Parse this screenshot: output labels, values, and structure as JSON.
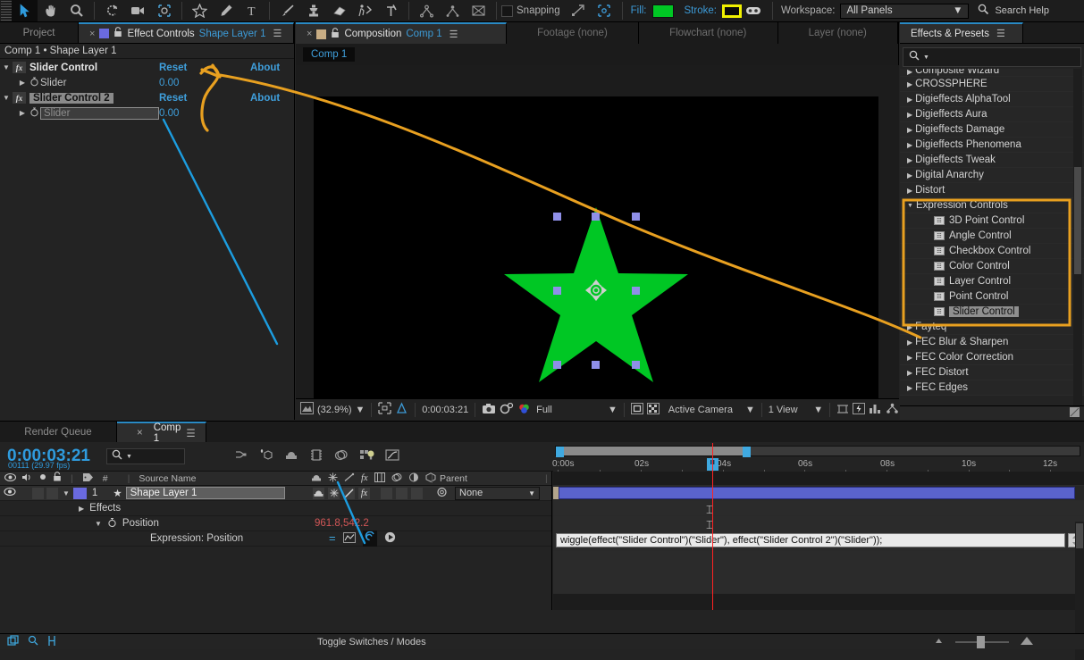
{
  "toolbar": {
    "tools": [
      {
        "name": "selection-tool",
        "glyph": "arrow",
        "selected": true
      },
      {
        "name": "hand-tool",
        "glyph": "hand",
        "selected": false
      },
      {
        "name": "zoom-tool",
        "glyph": "magnifier",
        "selected": false
      },
      {
        "name": "rotation-tool",
        "glyph": "rotate",
        "selected": false
      },
      {
        "name": "camera-tool",
        "glyph": "camera",
        "selected": false
      },
      {
        "name": "pan-behind-tool",
        "glyph": "anchor",
        "selected": false
      },
      {
        "name": "shape-tool",
        "glyph": "star",
        "selected": false
      },
      {
        "name": "pen-tool",
        "glyph": "pen",
        "selected": false
      },
      {
        "name": "type-tool",
        "glyph": "type",
        "selected": false
      },
      {
        "name": "brush-tool",
        "glyph": "brush",
        "selected": false
      },
      {
        "name": "clone-stamp-tool",
        "glyph": "stamp",
        "selected": false
      },
      {
        "name": "eraser-tool",
        "glyph": "eraser",
        "selected": false
      },
      {
        "name": "roto-brush-tool",
        "glyph": "roto",
        "selected": false
      },
      {
        "name": "puppet-pin-tool",
        "glyph": "pin",
        "selected": false
      }
    ],
    "axis_tools": [
      "local-axis",
      "world-axis",
      "view-axis"
    ],
    "snapping_label": "Snapping",
    "fill_label": "Fill:",
    "fill_color": "#00c724",
    "stroke_label": "Stroke:",
    "stroke_color": "#f0f000",
    "workspace_label": "Workspace:",
    "workspace_value": "All Panels",
    "search_help": "Search Help"
  },
  "effect_controls": {
    "tabs": [
      {
        "label": "Project",
        "active": false
      },
      {
        "label": "Effect Controls",
        "sub": "Shape Layer 1",
        "active": true
      }
    ],
    "breadcrumb": "Comp 1 • Shape Layer 1",
    "effects": [
      {
        "name": "Slider Control",
        "reset": "Reset",
        "about": "About",
        "selected": false,
        "property": {
          "label": "Slider",
          "value": "0.00",
          "editing": false
        }
      },
      {
        "name": "Slider Control 2",
        "reset": "Reset",
        "about": "About",
        "selected": true,
        "property": {
          "label": "Slider",
          "value": "0.00",
          "editing": true
        }
      }
    ]
  },
  "composition": {
    "tabs": [
      {
        "label": "Composition",
        "sub": "Comp 1",
        "active": true
      },
      {
        "label": "Footage (none)",
        "active": false
      },
      {
        "label": "Flowchart (none)",
        "active": false
      },
      {
        "label": "Layer (none)",
        "active": false
      }
    ],
    "comp_name_button": "Comp 1",
    "footer": {
      "zoom": "(32.9%)",
      "timecode": "0:00:03:21",
      "resolution": "Full",
      "camera": "Active Camera",
      "views": "1 View"
    },
    "shape": {
      "name": "star",
      "fill": "#00c724",
      "handle_color": "#8f8fe8"
    }
  },
  "effects_presets": {
    "title": "Effects & Presets",
    "search_placeholder": "",
    "items": [
      {
        "label": "Composite Wizard",
        "type": "category",
        "clipped": true
      },
      {
        "label": "CROSSPHERE",
        "type": "category"
      },
      {
        "label": "Digieffects AlphaTool",
        "type": "category"
      },
      {
        "label": "Digieffects Aura",
        "type": "category"
      },
      {
        "label": "Digieffects Damage",
        "type": "category"
      },
      {
        "label": "Digieffects Phenomena",
        "type": "category"
      },
      {
        "label": "Digieffects Tweak",
        "type": "category"
      },
      {
        "label": "Digital Anarchy",
        "type": "category"
      },
      {
        "label": "Distort",
        "type": "category"
      },
      {
        "label": "Expression Controls",
        "type": "category",
        "expanded": true
      },
      {
        "label": "3D Point Control",
        "type": "effect"
      },
      {
        "label": "Angle Control",
        "type": "effect"
      },
      {
        "label": "Checkbox Control",
        "type": "effect"
      },
      {
        "label": "Color Control",
        "type": "effect"
      },
      {
        "label": "Layer Control",
        "type": "effect"
      },
      {
        "label": "Point Control",
        "type": "effect"
      },
      {
        "label": "Slider Control",
        "type": "effect",
        "selected": true
      },
      {
        "label": "Fayteq",
        "type": "category"
      },
      {
        "label": "FEC Blur & Sharpen",
        "type": "category"
      },
      {
        "label": "FEC Color Correction",
        "type": "category"
      },
      {
        "label": "FEC Distort",
        "type": "category"
      },
      {
        "label": "FEC Edges",
        "type": "category"
      }
    ]
  },
  "timeline": {
    "tabs": [
      {
        "label": "Render Queue",
        "active": false
      },
      {
        "label": "Comp 1",
        "active": true
      }
    ],
    "timecode": "0:00:03:21",
    "frames": "00111 (29.97 fps)",
    "columns": {
      "source_name": "Source Name",
      "number": "#",
      "parent": "Parent"
    },
    "layer": {
      "index": "1",
      "name": "Shape Layer 1",
      "parent_value": "None",
      "properties": [
        {
          "label": "Effects",
          "indent": 1
        },
        {
          "label": "Position",
          "indent": 2,
          "value": "961.8,542.2"
        },
        {
          "label": "Expression: Position",
          "indent": 3
        }
      ]
    },
    "expression": "wiggle(effect(\"Slider Control\")(\"Slider\"), effect(\"Slider Control 2\")(\"Slider\"));",
    "ruler_ticks": [
      "0:00s",
      "02s",
      "04s",
      "06s",
      "08s",
      "10s",
      "12s"
    ],
    "footer": {
      "toggle_label": "Toggle Switches / Modes"
    }
  },
  "annotations": {
    "orange_color": "#e8a020",
    "blue_color": "#1c9de0"
  }
}
